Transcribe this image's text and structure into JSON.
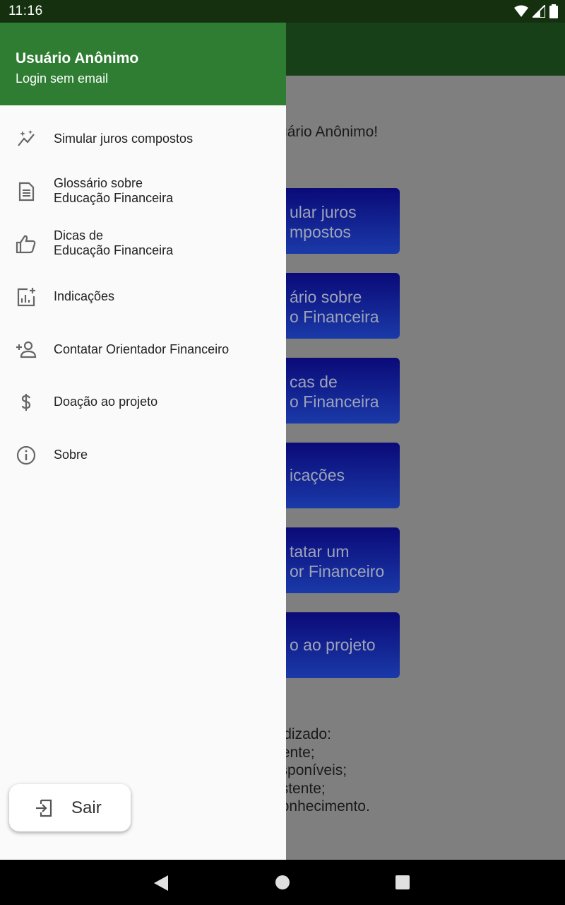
{
  "status_bar": {
    "time": "11:16"
  },
  "background": {
    "greeting": "o, Usuário Anônimo!",
    "buttons": [
      {
        "line1": "ular juros",
        "line2": "mpostos"
      },
      {
        "line1": "ário sobre",
        "line2": "o Financeira"
      },
      {
        "line1": "cas de",
        "line2": "o Financeira"
      },
      {
        "line1": "icações",
        "line2": ""
      },
      {
        "line1": "tatar um",
        "line2": "or Financeiro"
      },
      {
        "line1": "o ao projeto",
        "line2": ""
      }
    ],
    "text_lines": [
      "o aprendizado:",
      "nanalmente;",
      "ções disponíveis;",
      "údo existente;",
      "es de conhecimento."
    ]
  },
  "drawer": {
    "user_name": "Usuário Anônimo",
    "user_sub": "Login sem email",
    "items": [
      {
        "icon": "auto-awesome-icon",
        "line1": "Simular juros compostos",
        "line2": ""
      },
      {
        "icon": "article-icon",
        "line1": "Glossário sobre",
        "line2": "Educação Financeira"
      },
      {
        "icon": "thumb-up-icon",
        "line1": "Dicas de",
        "line2": "Educação Financeira"
      },
      {
        "icon": "insights-icon",
        "line1": "Indicações",
        "line2": ""
      },
      {
        "icon": "person-add-icon",
        "line1": "Contatar Orientador Financeiro",
        "line2": ""
      },
      {
        "icon": "dollar-icon",
        "line1": "Doação ao projeto",
        "line2": ""
      },
      {
        "icon": "info-icon",
        "line1": "Sobre",
        "line2": ""
      }
    ],
    "logout_label": "Sair"
  },
  "colors": {
    "drawer_header": "#2e7d32",
    "appbar": "#173f18"
  }
}
